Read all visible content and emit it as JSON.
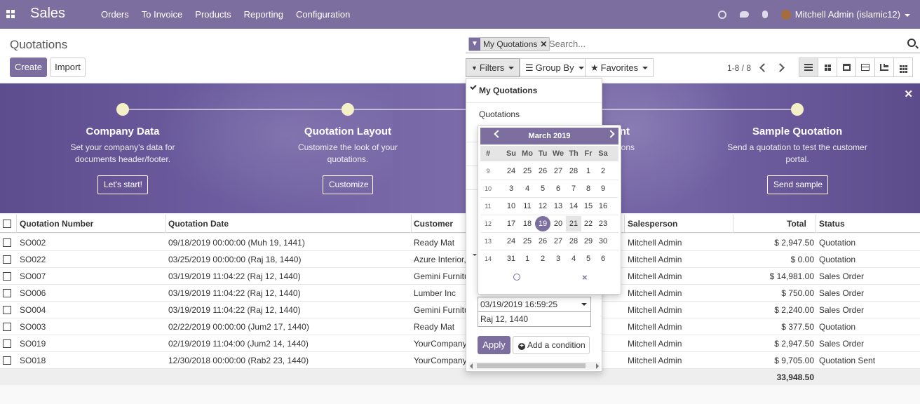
{
  "nav": {
    "brand": "Sales",
    "menu": [
      "Orders",
      "To Invoice",
      "Products",
      "Reporting",
      "Configuration"
    ],
    "user": "Mitchell Admin (islamic12)"
  },
  "cp": {
    "breadcrumb": "Quotations",
    "create": "Create",
    "import": "Import",
    "facet": "My Quotations",
    "search_placeholder": "Search...",
    "filters": "Filters",
    "groupby": "Group By",
    "favorites": "Favorites",
    "pager": "1-8 / 8"
  },
  "banner": {
    "steps": [
      {
        "title": "Company Data",
        "desc": "Set your company's data for documents header/footer.",
        "button": "Let's start!"
      },
      {
        "title": "Quotation Layout",
        "desc": "Customize the look of your quotations.",
        "button": "Customize"
      },
      {
        "title": "nt",
        "desc": "ons",
        "button": ""
      },
      {
        "title": "Sample Quotation",
        "desc": "Send a quotation to test the customer portal.",
        "button": "Send sample"
      }
    ]
  },
  "table": {
    "headers": [
      "Quotation Number",
      "Quotation Date",
      "Customer",
      "Salesperson",
      "Total",
      "Status"
    ],
    "rows": [
      {
        "num": "SO002",
        "date": "09/18/2019 00:00:00 (Muh 19, 1441)",
        "customer": "Ready Mat",
        "sales": "Mitchell Admin",
        "total": "$ 2,947.50",
        "status": "Quotation"
      },
      {
        "num": "SO022",
        "date": "03/25/2019 00:00:00 (Raj 18, 1440)",
        "customer": "Azure Interior,",
        "sales": "Mitchell Admin",
        "total": "$ 0.00",
        "status": "Quotation"
      },
      {
        "num": "SO007",
        "date": "03/19/2019 11:04:22 (Raj 12, 1440)",
        "customer": "Gemini Furnitu",
        "sales": "Mitchell Admin",
        "total": "$ 14,981.00",
        "status": "Sales Order"
      },
      {
        "num": "SO006",
        "date": "03/19/2019 11:04:22 (Raj 12, 1440)",
        "customer": "Lumber Inc",
        "sales": "Mitchell Admin",
        "total": "$ 750.00",
        "status": "Sales Order"
      },
      {
        "num": "SO004",
        "date": "03/19/2019 11:04:22 (Raj 12, 1440)",
        "customer": "Gemini Furnitu",
        "sales": "Mitchell Admin",
        "total": "$ 2,240.00",
        "status": "Sales Order"
      },
      {
        "num": "SO003",
        "date": "02/22/2019 00:00:00 (Jum2 17, 1440)",
        "customer": "Ready Mat",
        "sales": "Mitchell Admin",
        "total": "$ 377.50",
        "status": "Quotation"
      },
      {
        "num": "SO019",
        "date": "02/19/2019 11:04:00 (Jum2 14, 1440)",
        "customer": "YourCompany,",
        "sales": "Mitchell Admin",
        "total": "$ 2,947.50",
        "status": "Sales Order"
      },
      {
        "num": "SO018",
        "date": "12/30/2018 00:00:00 (Rab2 23, 1440)",
        "customer": "YourCompany,",
        "sales": "Mitchell Admin",
        "total": "$ 9,705.00",
        "status": "Quotation Sent"
      }
    ],
    "footer_total": "33,948.50"
  },
  "filters": {
    "my_quotations": "My Quotations",
    "quotations": "Quotations",
    "date_value": "03/19/2019 16:59:25",
    "hijri_value": "Raj 12, 1440",
    "apply": "Apply",
    "add_condition": "Add a condition"
  },
  "datepicker": {
    "month": "March 2019",
    "weekdays": [
      "#",
      "Su",
      "Mo",
      "Tu",
      "We",
      "Th",
      "Fr",
      "Sa"
    ],
    "weeks": [
      [
        "9",
        "24",
        "25",
        "26",
        "27",
        "28",
        "1",
        "2"
      ],
      [
        "10",
        "3",
        "4",
        "5",
        "6",
        "7",
        "8",
        "9"
      ],
      [
        "11",
        "10",
        "11",
        "12",
        "13",
        "14",
        "15",
        "16"
      ],
      [
        "12",
        "17",
        "18",
        "19",
        "20",
        "21",
        "22",
        "23"
      ],
      [
        "13",
        "24",
        "25",
        "26",
        "27",
        "28",
        "29",
        "30"
      ],
      [
        "14",
        "31",
        "1",
        "2",
        "3",
        "4",
        "5",
        "6"
      ]
    ],
    "clear": "×"
  },
  "colors": {
    "brand": "#7c6e9e",
    "banner": "#6d5da0"
  }
}
